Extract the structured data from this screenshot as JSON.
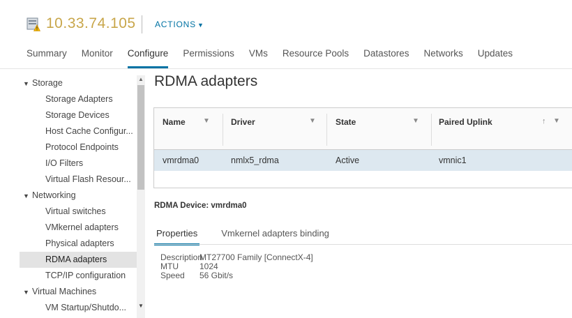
{
  "header": {
    "host_name": "10.33.74.105",
    "host_icon": "host-warning-icon",
    "actions_label": "ACTIONS"
  },
  "tabs": [
    {
      "label": "Summary"
    },
    {
      "label": "Monitor"
    },
    {
      "label": "Configure",
      "active": true
    },
    {
      "label": "Permissions"
    },
    {
      "label": "VMs"
    },
    {
      "label": "Resource Pools"
    },
    {
      "label": "Datastores"
    },
    {
      "label": "Networks"
    },
    {
      "label": "Updates"
    }
  ],
  "sidebar": {
    "items": [
      {
        "label": "Storage",
        "type": "group"
      },
      {
        "label": "Storage Adapters",
        "type": "child"
      },
      {
        "label": "Storage Devices",
        "type": "child"
      },
      {
        "label": "Host Cache Configur...",
        "type": "child"
      },
      {
        "label": "Protocol Endpoints",
        "type": "child"
      },
      {
        "label": "I/O Filters",
        "type": "child"
      },
      {
        "label": "Virtual Flash Resour...",
        "type": "child"
      },
      {
        "label": "Networking",
        "type": "group"
      },
      {
        "label": "Virtual switches",
        "type": "child"
      },
      {
        "label": "VMkernel adapters",
        "type": "child"
      },
      {
        "label": "Physical adapters",
        "type": "child"
      },
      {
        "label": "RDMA adapters",
        "type": "child",
        "selected": true
      },
      {
        "label": "TCP/IP configuration",
        "type": "child"
      },
      {
        "label": "Virtual Machines",
        "type": "group"
      },
      {
        "label": "VM Startup/Shutdo...",
        "type": "child"
      }
    ]
  },
  "main": {
    "title": "RDMA adapters",
    "table": {
      "columns": [
        "Name",
        "Driver",
        "State",
        "Paired Uplink"
      ],
      "rows": [
        {
          "name": "vmrdma0",
          "driver": "nmlx5_rdma",
          "state": "Active",
          "uplink": "vmnic1"
        }
      ]
    },
    "device_label": "RDMA Device: vmrdma0",
    "subtabs": [
      {
        "label": "Properties",
        "active": true
      },
      {
        "label": "Vmkernel adapters binding"
      }
    ],
    "properties": [
      {
        "key": "Description",
        "value": "MT27700 Family [ConnectX-4]"
      },
      {
        "key": "MTU",
        "value": "1024"
      },
      {
        "key": "Speed",
        "value": "56 Gbit/s"
      }
    ]
  },
  "colors": {
    "accent": "#0072a3",
    "selected_row": "#dde8f0",
    "warning": "#f0b400"
  }
}
